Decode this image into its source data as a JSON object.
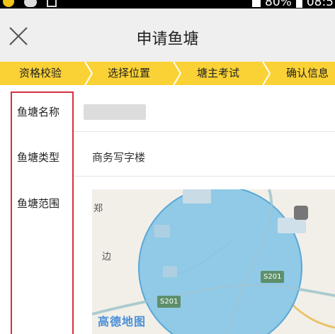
{
  "status_bar": {
    "battery": "80%",
    "time": "08:5"
  },
  "header": {
    "title": "申请鱼塘"
  },
  "steps": [
    {
      "label": "资格校验"
    },
    {
      "label": "选择位置"
    },
    {
      "label": "塘主考试"
    },
    {
      "label": "确认信息"
    }
  ],
  "form": {
    "name_label": "鱼塘名称",
    "type_label": "鱼塘类型",
    "type_value": "商务写字楼",
    "range_label": "鱼塘范围"
  },
  "map": {
    "logo": "高德地图",
    "roads": [
      "S201",
      "S201"
    ],
    "places": [
      "郑",
      "边"
    ]
  },
  "colors": {
    "accent_yellow": "#fbd235",
    "highlight_red": "#d8303e",
    "map_circle": "#7fc3e6"
  },
  "icons": {
    "close": "close-icon",
    "step_arrow": "chevron-right-icon"
  }
}
